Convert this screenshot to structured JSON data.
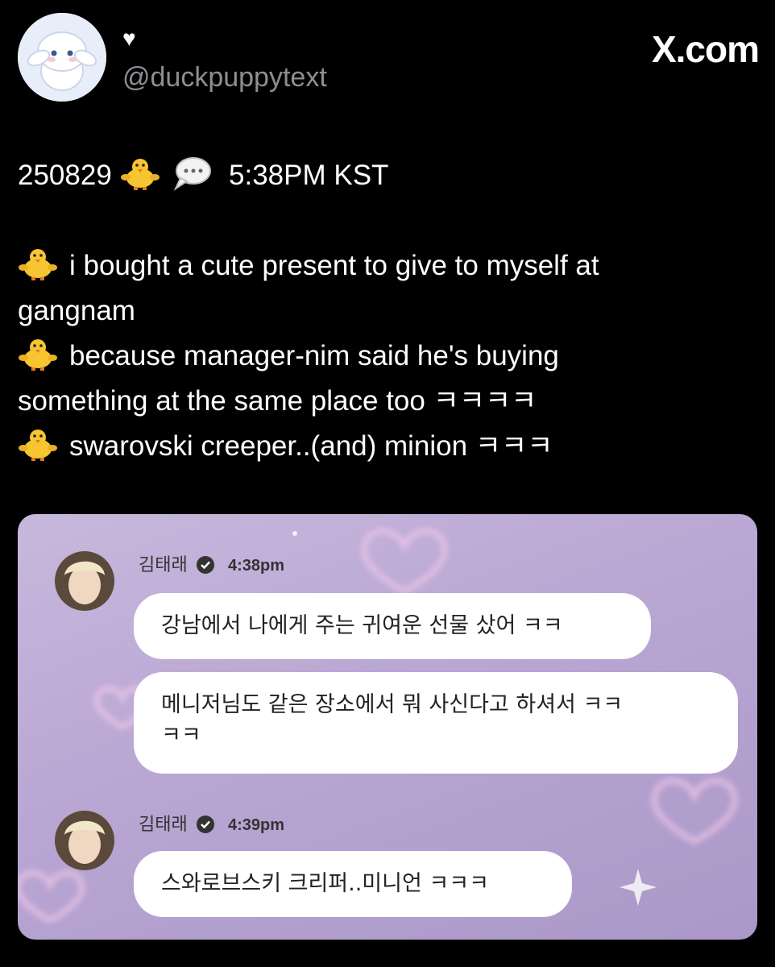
{
  "profile": {
    "display_name": "♥",
    "handle": "@duckpuppytext"
  },
  "brand": "X.com",
  "tweet": {
    "date_code": "250829",
    "time": "5:38PM KST",
    "lines": [
      "i bought a cute present to give to myself at",
      "gangnam",
      "because manager-nim said he's buying",
      "something at the same place too ㅋㅋㅋㅋ",
      "swarovski creeper..(and) minion ㅋㅋㅋ"
    ]
  },
  "chat": {
    "messages": [
      {
        "name": "김태래",
        "time": "4:38pm",
        "bubbles": [
          "강남에서 나에게 주는 귀여운 선물 샀어 ㅋㅋ",
          "메니저님도 같은 장소에서 뭐 사신다고 하셔서 ㅋㅋ",
          "ㅋㅋ"
        ]
      },
      {
        "name": "김태래",
        "time": "4:39pm",
        "bubbles": [
          "스와로브스키 크리퍼..미니언 ㅋㅋㅋ"
        ]
      }
    ]
  },
  "icons": {
    "emoji_1": "chick-icon",
    "emoji_2": "speech-bubble-icon",
    "verified": "verified-badge-icon"
  }
}
